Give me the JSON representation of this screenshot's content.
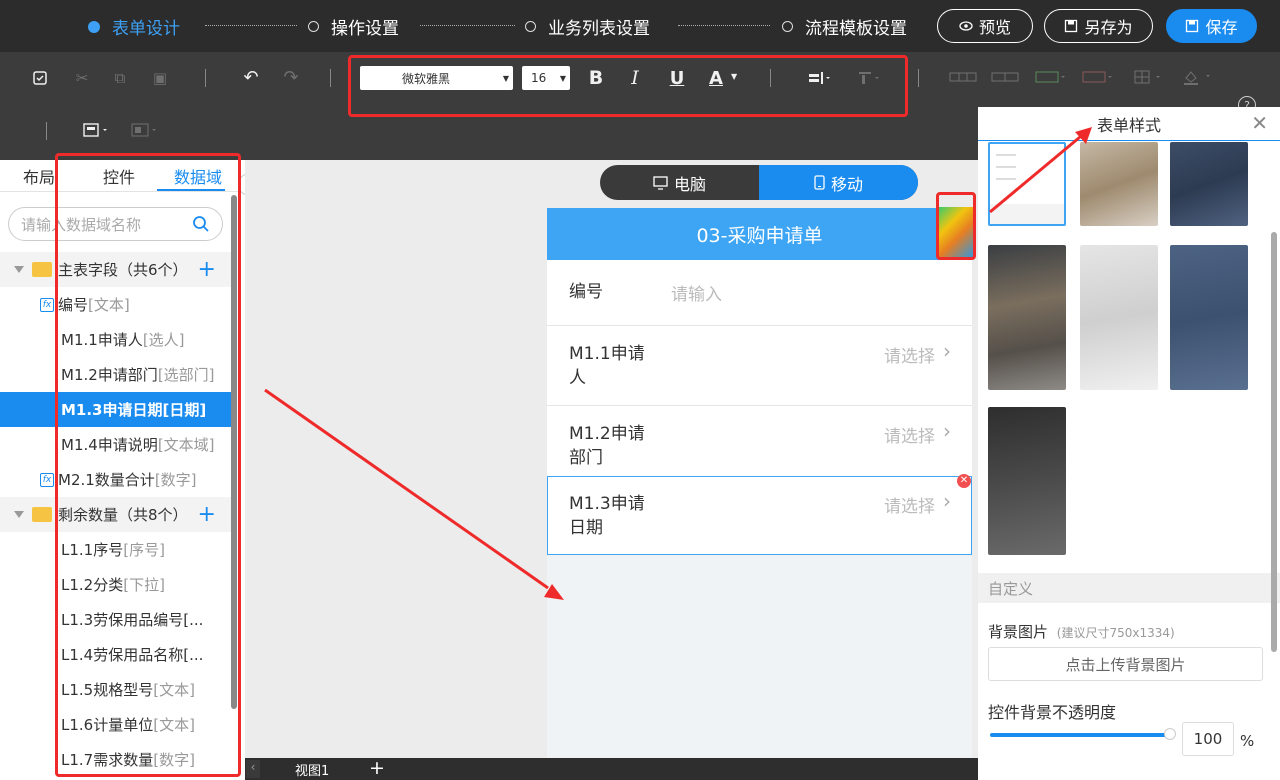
{
  "header": {
    "steps": [
      {
        "label": "表单设计",
        "active": true
      },
      {
        "label": "操作设置",
        "active": false
      },
      {
        "label": "业务列表设置",
        "active": false
      },
      {
        "label": "流程模板设置",
        "active": false
      }
    ],
    "buttons": {
      "preview": "预览",
      "saveas": "另存为",
      "save": "保存"
    }
  },
  "toolbar": {
    "font_family": "微软雅黑",
    "font_size": "16",
    "bold": "B",
    "italic": "I",
    "underline": "U",
    "font_color": "A"
  },
  "left_panel": {
    "tabs": [
      "布局",
      "控件",
      "数据域"
    ],
    "active_tab": "数据域",
    "search_placeholder": "请输入数据域名称",
    "rows": [
      {
        "kind": "group",
        "name": "主表字段（共6个）"
      },
      {
        "kind": "field",
        "name": "编号",
        "type": "[文本]",
        "fx": true
      },
      {
        "kind": "field",
        "name": "M1.1申请人",
        "type": "[选人]"
      },
      {
        "kind": "field",
        "name": "M1.2申请部门",
        "type": "[选部门]"
      },
      {
        "kind": "field",
        "name": "M1.3申请日期",
        "type": "[日期]",
        "selected": true
      },
      {
        "kind": "field",
        "name": "M1.4申请说明",
        "type": "[文本域]"
      },
      {
        "kind": "field",
        "name": "M2.1数量合计",
        "type": "[数字]",
        "fx": true
      },
      {
        "kind": "group",
        "name": "剩余数量（共8个）"
      },
      {
        "kind": "field",
        "name": "L1.1序号",
        "type": "[序号]"
      },
      {
        "kind": "field",
        "name": "L1.2分类",
        "type": "[下拉]"
      },
      {
        "kind": "field",
        "name": "L1.3劳保用品编号[...",
        "type": ""
      },
      {
        "kind": "field",
        "name": "L1.4劳保用品名称[...",
        "type": ""
      },
      {
        "kind": "field",
        "name": "L1.5规格型号",
        "type": "[文本]"
      },
      {
        "kind": "field",
        "name": "L1.6计量单位",
        "type": "[文本]"
      },
      {
        "kind": "field",
        "name": "L1.7需求数量",
        "type": "[数字]"
      }
    ]
  },
  "device_toggle": {
    "desktop": "电脑",
    "mobile": "移动",
    "active": "移动"
  },
  "form": {
    "title": "03-采购申请单",
    "fields": [
      {
        "label": "编号",
        "placeholder": "请输入"
      },
      {
        "label": "M1.1申请\n人",
        "placeholder": "请选择"
      },
      {
        "label": "M1.2申请\n部门",
        "placeholder": "请选择"
      },
      {
        "label": "M1.3申请\n日期",
        "placeholder": "请选择"
      }
    ]
  },
  "bottom": {
    "view_tab": "视图1",
    "add": "+"
  },
  "right_panel": {
    "title": "表单样式",
    "custom_section": "自定义",
    "bg_label": "背景图片",
    "bg_hint": "(建议尺寸750x1334)",
    "upload_button": "点击上传背景图片",
    "opacity_label": "控件背景不透明度",
    "opacity_value": "100",
    "opacity_unit": "%"
  },
  "colors": {
    "accent": "#1a8cf0",
    "header_blue": "#3da5f4",
    "annotation_red": "#ef2a2a"
  }
}
